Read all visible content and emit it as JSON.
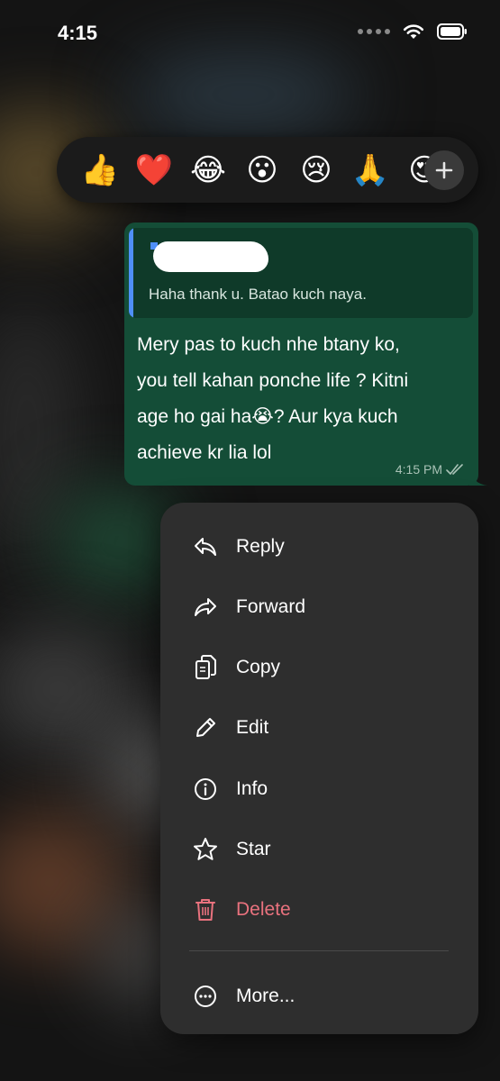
{
  "status_bar": {
    "time": "4:15"
  },
  "reactions": {
    "items": [
      {
        "emoji": "👍",
        "name": "thumbs-up-reaction"
      },
      {
        "emoji": "❤️",
        "name": "heart-reaction"
      },
      {
        "emoji": "😂",
        "name": "laughing-reaction"
      },
      {
        "emoji": "😮",
        "name": "surprised-reaction"
      },
      {
        "emoji": "😢",
        "name": "crying-reaction"
      },
      {
        "emoji": "🙏",
        "name": "pray-reaction"
      },
      {
        "emoji": "😍",
        "name": "heart-eyes-reaction"
      }
    ],
    "more_icon": "plus-icon"
  },
  "message": {
    "quote_text": "Haha thank u. Batao kuch naya.",
    "lines": [
      "Mery pas to kuch nhe btany ko,",
      "you tell kahan ponche life ? Kitni",
      "age ho gai ha😭? Aur kya kuch",
      "achieve kr lia lol"
    ],
    "time": "4:15 PM",
    "status_icon": "double-check-icon"
  },
  "menu": {
    "items": [
      {
        "label": "Reply",
        "icon": "reply-icon"
      },
      {
        "label": "Forward",
        "icon": "forward-icon"
      },
      {
        "label": "Copy",
        "icon": "copy-icon"
      },
      {
        "label": "Edit",
        "icon": "pencil-icon"
      },
      {
        "label": "Info",
        "icon": "info-icon"
      },
      {
        "label": "Star",
        "icon": "star-icon"
      },
      {
        "label": "Delete",
        "icon": "trash-icon"
      },
      {
        "label": "More...",
        "icon": "ellipsis-circle-icon"
      }
    ]
  },
  "colors": {
    "bubble": "#144d37",
    "quote_accent": "#4f8ff7",
    "menu_bg": "#2e2e2e",
    "danger": "#e9727e"
  }
}
